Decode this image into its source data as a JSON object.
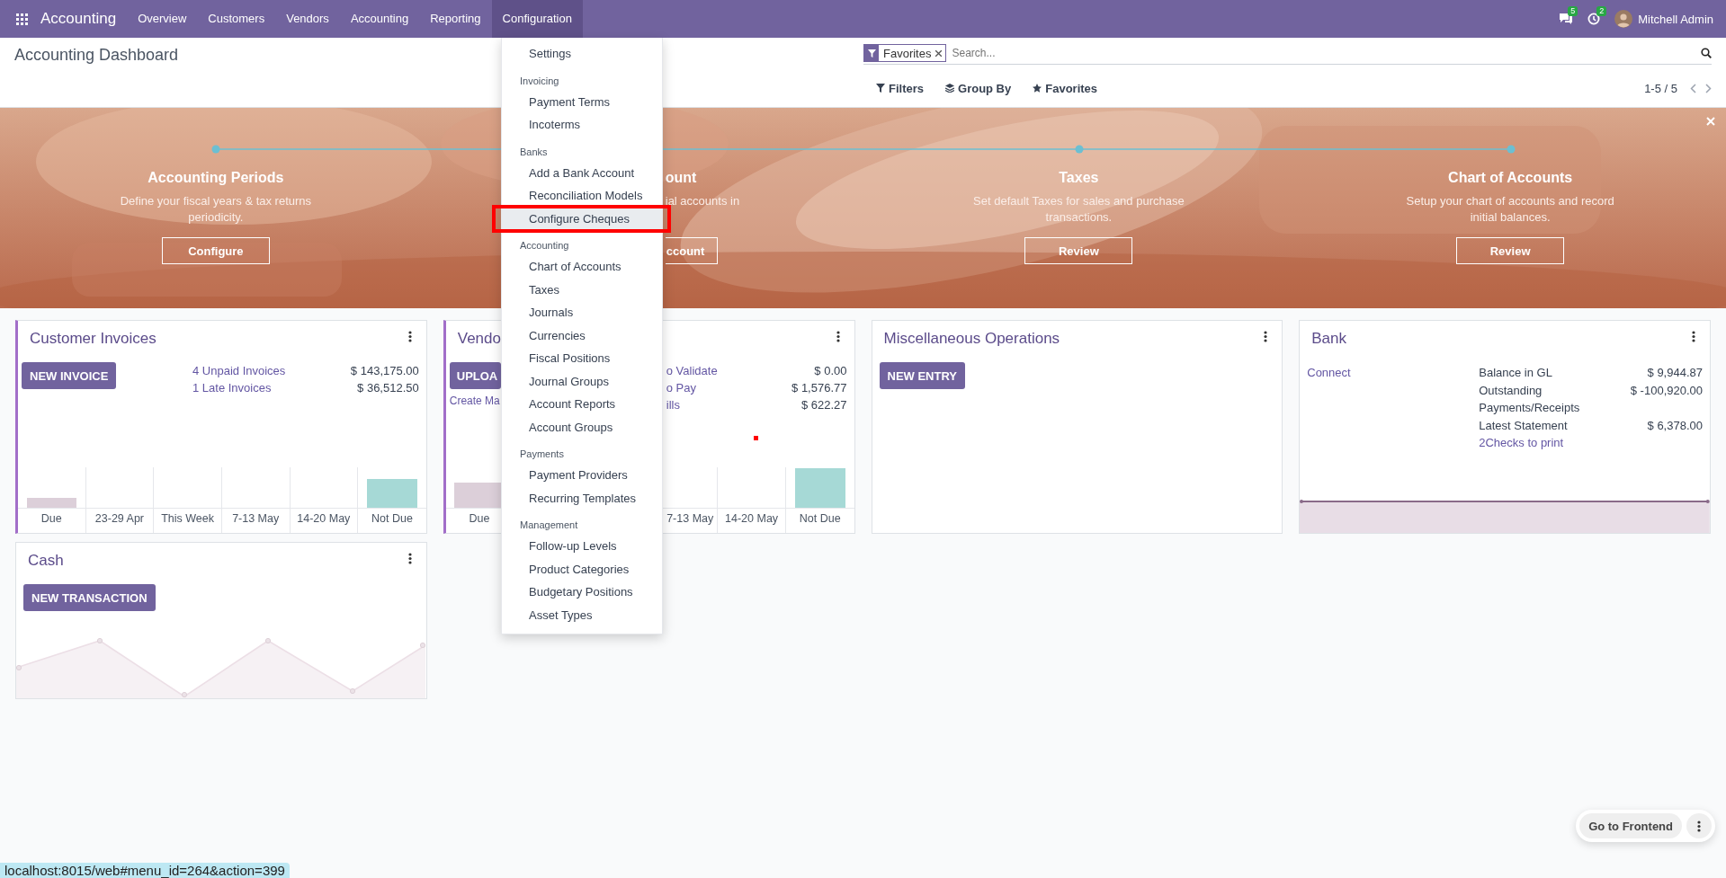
{
  "navbar": {
    "app_name": "Accounting",
    "menu": [
      {
        "label": "Overview",
        "selected": false
      },
      {
        "label": "Customers",
        "selected": false
      },
      {
        "label": "Vendors",
        "selected": false
      },
      {
        "label": "Accounting",
        "selected": false
      },
      {
        "label": "Reporting",
        "selected": false
      },
      {
        "label": "Configuration",
        "selected": true
      }
    ],
    "messages_badge": "5",
    "activities_badge": "2",
    "user": "Mitchell Admin"
  },
  "control_panel": {
    "title": "Accounting Dashboard",
    "search": {
      "facet": "Favorites",
      "placeholder": "Search..."
    },
    "buttons": [
      "Filters",
      "Group By",
      "Favorites"
    ],
    "pager": "1-5 / 5"
  },
  "onboarding": {
    "steps": [
      {
        "kind": "full",
        "title": "Accounting Periods",
        "description": "Define your fiscal years & tax returns periodicity.",
        "button": "Configure"
      },
      {
        "kind": "cut",
        "title": "ount",
        "description": "ial accounts in",
        "button": "ccount"
      },
      {
        "kind": "full",
        "title": "Taxes",
        "description": "Set default Taxes for sales and purchase transactions.",
        "button": "Review"
      },
      {
        "kind": "full",
        "title": "Chart of Accounts",
        "description": "Setup your chart of accounts and record initial balances.",
        "button": "Review"
      }
    ]
  },
  "dashboard": [
    {
      "kind": "sale",
      "title": "Customer Invoices",
      "button": "NEW INVOICE",
      "stats": [
        {
          "label": "4 Unpaid Invoices",
          "amount": "$ 143,175.00"
        },
        {
          "label": "1 Late Invoices",
          "amount": "$ 36,512.50"
        }
      ],
      "chart_labels": [
        "Due",
        "23-29 Apr",
        "This Week",
        "7-13 May",
        "14-20 May",
        "Not Due"
      ]
    },
    {
      "kind": "purchase",
      "title": "Vendo",
      "button": "UPLOA",
      "link": "Create Ma",
      "stats": [
        {
          "label": "o Validate",
          "amount": "$ 0.00"
        },
        {
          "label": "o Pay",
          "amount": "$ 1,576.77"
        },
        {
          "label": "ills",
          "amount": "$ 622.27"
        }
      ],
      "chart_labels": [
        "Due",
        "7-13 May",
        "14-20 May",
        "Not Due"
      ]
    },
    {
      "kind": "general",
      "title": "Miscellaneous Operations",
      "button": "NEW ENTRY"
    },
    {
      "kind": "bank",
      "title": "Bank",
      "link": "Connect",
      "stats": [
        {
          "label": "Balance in GL",
          "amount": "$ 9,944.87"
        },
        {
          "label": "Outstanding Payments/Receipts",
          "amount": "$ -100,920.00"
        },
        {
          "label": "Latest Statement",
          "amount": "$ 6,378.00"
        }
      ],
      "footer_link": "2Checks to print"
    },
    {
      "kind": "cash",
      "title": "Cash",
      "button": "NEW TRANSACTION"
    }
  ],
  "config_menu": {
    "sections": [
      {
        "items": [
          {
            "label": "Settings",
            "selected": false
          }
        ]
      },
      {
        "header": "Invoicing",
        "items": [
          {
            "label": "Payment Terms",
            "selected": false
          },
          {
            "label": "Incoterms",
            "selected": false
          }
        ]
      },
      {
        "header": "Banks",
        "items": [
          {
            "label": "Add a Bank Account",
            "selected": false
          },
          {
            "label": "Reconciliation Models",
            "selected": false
          },
          {
            "label": "Configure Cheques",
            "selected": true
          }
        ]
      },
      {
        "header": "Accounting",
        "items": [
          {
            "label": "Chart of Accounts",
            "selected": false
          },
          {
            "label": "Taxes",
            "selected": false
          },
          {
            "label": "Journals",
            "selected": false
          },
          {
            "label": "Currencies",
            "selected": false
          },
          {
            "label": "Fiscal Positions",
            "selected": false
          },
          {
            "label": "Journal Groups",
            "selected": false
          },
          {
            "label": "Account Reports",
            "selected": false
          },
          {
            "label": "Account Groups",
            "selected": false
          }
        ]
      },
      {
        "header": "Payments",
        "items": [
          {
            "label": "Payment Providers",
            "selected": false
          },
          {
            "label": "Recurring Templates",
            "selected": false
          }
        ]
      },
      {
        "header": "Management",
        "items": [
          {
            "label": "Follow-up Levels",
            "selected": false
          },
          {
            "label": "Product Categories",
            "selected": false
          },
          {
            "label": "Budgetary Positions",
            "selected": false
          },
          {
            "label": "Asset Types",
            "selected": false
          }
        ]
      }
    ]
  },
  "frontend_button": "Go to Frontend",
  "status_url": "localhost:8015/web#menu_id=264&action=399"
}
